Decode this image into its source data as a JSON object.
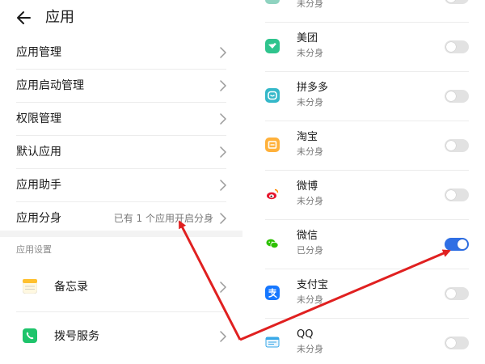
{
  "header": {
    "title": "应用"
  },
  "menu": [
    {
      "label": "应用管理",
      "status": ""
    },
    {
      "label": "应用启动管理",
      "status": ""
    },
    {
      "label": "权限管理",
      "status": ""
    },
    {
      "label": "默认应用",
      "status": ""
    },
    {
      "label": "应用助手",
      "status": ""
    },
    {
      "label": "应用分身",
      "status": "已有 1 个应用开启分身"
    }
  ],
  "settings": {
    "section_title": "应用设置",
    "items": [
      {
        "label": "备忘录",
        "icon": "memo-icon"
      },
      {
        "label": "拨号服务",
        "icon": "phone-icon"
      }
    ]
  },
  "apps": [
    {
      "name": "",
      "status": "未分身",
      "enabled": false,
      "icon": "app-icon"
    },
    {
      "name": "美团",
      "status": "未分身",
      "enabled": false,
      "icon": "meituan-icon",
      "color": "#2fc48d"
    },
    {
      "name": "拼多多",
      "status": "未分身",
      "enabled": false,
      "icon": "pinduoduo-icon",
      "color": "#35b8c9"
    },
    {
      "name": "淘宝",
      "status": "未分身",
      "enabled": false,
      "icon": "taobao-icon",
      "color": "#ffb13b"
    },
    {
      "name": "微博",
      "status": "未分身",
      "enabled": false,
      "icon": "weibo-icon",
      "color": "#e6162d"
    },
    {
      "name": "微信",
      "status": "已分身",
      "enabled": true,
      "icon": "wechat-icon",
      "color": "#2dc100"
    },
    {
      "name": "支付宝",
      "status": "未分身",
      "enabled": false,
      "icon": "alipay-icon",
      "color": "#1677ff"
    },
    {
      "name": "QQ",
      "status": "未分身",
      "enabled": false,
      "icon": "qq-icon",
      "color": "#39a9e8"
    }
  ],
  "colors": {
    "toggle_on": "#2f6fe4",
    "arrow": "#e02020"
  }
}
